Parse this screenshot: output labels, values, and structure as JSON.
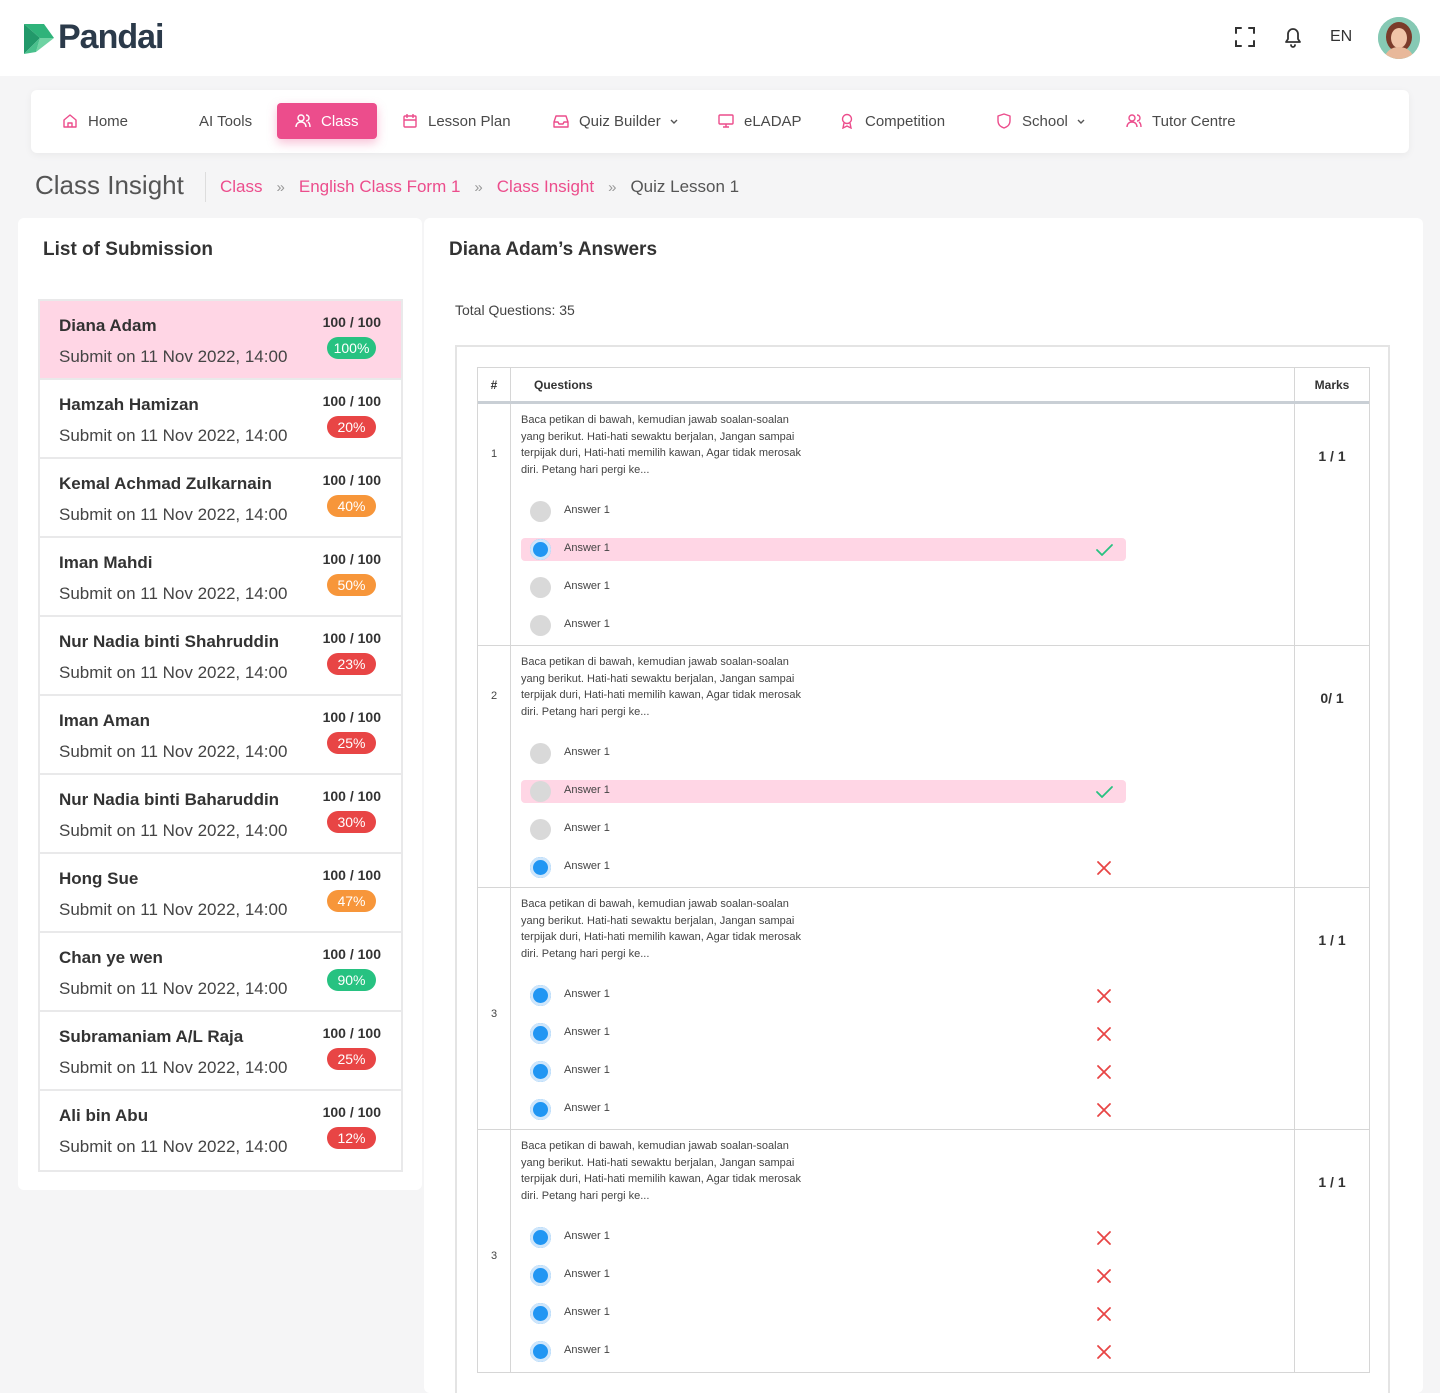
{
  "header": {
    "brand": "Pandai",
    "language": "EN",
    "colors": {
      "accent": "#ec4d8c",
      "logo_green": "#2fb37a",
      "text_dark": "#2b3a4a"
    }
  },
  "nav": {
    "items": [
      {
        "label": "Home",
        "icon": "home-icon"
      },
      {
        "label": "AI Tools",
        "icon": ""
      },
      {
        "label": "Class",
        "icon": "users-icon",
        "active": true
      },
      {
        "label": "Lesson Plan",
        "icon": "calendar-icon"
      },
      {
        "label": "Quiz Builder",
        "icon": "inbox-icon",
        "dropdown": true
      },
      {
        "label": "eLADAP",
        "icon": "monitor-icon"
      },
      {
        "label": "Competition",
        "icon": "award-icon"
      },
      {
        "label": "School",
        "icon": "shield-icon",
        "dropdown": true
      },
      {
        "label": "Tutor Centre",
        "icon": "users-icon"
      }
    ]
  },
  "page": {
    "title": "Class Insight",
    "breadcrumb": [
      "Class",
      "English Class Form 1",
      "Class Insight",
      "Quiz Lesson 1"
    ]
  },
  "submissions": {
    "title": "List of Submission",
    "items": [
      {
        "name": "Diana Adam",
        "date": "Submit on 11 Nov 2022, 14:00",
        "score": "100 / 100",
        "percent": "100%",
        "badge_color": "#27c281",
        "active": true
      },
      {
        "name": "Hamzah Hamizan",
        "date": "Submit on 11 Nov 2022, 14:00",
        "score": "100 / 100",
        "percent": "20%",
        "badge_color": "#e84545"
      },
      {
        "name": "Kemal Achmad Zulkarnain",
        "date": "Submit on 11 Nov 2022, 14:00",
        "score": "100 / 100",
        "percent": "40%",
        "badge_color": "#f7963a"
      },
      {
        "name": "Iman Mahdi",
        "date": "Submit on 11 Nov 2022, 14:00",
        "score": "100 / 100",
        "percent": "50%",
        "badge_color": "#f7963a"
      },
      {
        "name": "Nur Nadia binti Shahruddin",
        "date": "Submit on 11 Nov 2022, 14:00",
        "score": "100 / 100",
        "percent": "23%",
        "badge_color": "#e84545"
      },
      {
        "name": "Iman Aman",
        "date": "Submit on 11 Nov 2022, 14:00",
        "score": "100 / 100",
        "percent": "25%",
        "badge_color": "#e84545"
      },
      {
        "name": "Nur Nadia binti Baharuddin",
        "date": "Submit on 11 Nov 2022, 14:00",
        "score": "100 / 100",
        "percent": "30%",
        "badge_color": "#e84545"
      },
      {
        "name": "Hong Sue",
        "date": "Submit on 11 Nov 2022, 14:00",
        "score": "100 / 100",
        "percent": "47%",
        "badge_color": "#f7963a"
      },
      {
        "name": "Chan ye wen",
        "date": "Submit on 11 Nov 2022, 14:00",
        "score": "100 / 100",
        "percent": "90%",
        "badge_color": "#27c281"
      },
      {
        "name": "Subramaniam A/L Raja",
        "date": "Submit on 11 Nov 2022, 14:00",
        "score": "100 / 100",
        "percent": "25%",
        "badge_color": "#e84545"
      },
      {
        "name": "Ali bin Abu",
        "date": "Submit on 11 Nov 2022, 14:00",
        "score": "100 / 100",
        "percent": "12%",
        "badge_color": "#e84545"
      }
    ]
  },
  "answers": {
    "title": "Diana Adam’s Answers",
    "total_questions": "Total Questions: 35",
    "columns": {
      "num": "#",
      "questions": "Questions",
      "marks": "Marks"
    },
    "questions": [
      {
        "num": "1",
        "text": "Baca petikan di bawah, kemudian jawab soalan-soalan yang berikut. Hati-hati sewaktu berjalan, Jangan sampai terpijak duri, Hati-hati memilih kawan, Agar tidak merosak diri. Petang hari pergi ke...",
        "marks": "1 / 1",
        "options": [
          {
            "label": "Answer 1",
            "selected": false,
            "highlight": false,
            "result": ""
          },
          {
            "label": "Answer 1",
            "selected": true,
            "highlight": true,
            "result": "correct"
          },
          {
            "label": "Answer 1",
            "selected": false,
            "highlight": false,
            "result": ""
          },
          {
            "label": "Answer 1",
            "selected": false,
            "highlight": false,
            "result": ""
          }
        ]
      },
      {
        "num": "2",
        "text": "Baca petikan di bawah, kemudian jawab soalan-soalan yang berikut. Hati-hati sewaktu berjalan, Jangan sampai terpijak duri, Hati-hati memilih kawan, Agar tidak merosak diri. Petang hari pergi ke...",
        "marks": "0/ 1",
        "options": [
          {
            "label": "Answer 1",
            "selected": false,
            "highlight": false,
            "result": ""
          },
          {
            "label": "Answer 1",
            "selected": false,
            "highlight": true,
            "result": "correct"
          },
          {
            "label": "Answer 1",
            "selected": false,
            "highlight": false,
            "result": ""
          },
          {
            "label": "Answer 1",
            "selected": true,
            "highlight": false,
            "result": "wrong"
          }
        ]
      },
      {
        "num": "3",
        "text": "Baca petikan di bawah, kemudian jawab soalan-soalan yang berikut. Hati-hati sewaktu berjalan, Jangan sampai terpijak duri, Hati-hati memilih kawan, Agar tidak merosak diri. Petang hari pergi ke...",
        "marks": "1 / 1",
        "options": [
          {
            "label": "Answer 1",
            "selected": true,
            "highlight": false,
            "result": "wrong"
          },
          {
            "label": "Answer 1",
            "selected": true,
            "highlight": false,
            "result": "wrong"
          },
          {
            "label": "Answer 1",
            "selected": true,
            "highlight": false,
            "result": "wrong"
          },
          {
            "label": "Answer 1",
            "selected": true,
            "highlight": false,
            "result": "wrong"
          }
        ]
      },
      {
        "num": "3",
        "text": "Baca petikan di bawah, kemudian jawab soalan-soalan yang berikut. Hati-hati sewaktu berjalan, Jangan sampai terpijak duri, Hati-hati memilih kawan, Agar tidak merosak diri. Petang hari pergi ke...",
        "marks": "1 / 1",
        "options": [
          {
            "label": "Answer 1",
            "selected": true,
            "highlight": false,
            "result": "wrong"
          },
          {
            "label": "Answer 1",
            "selected": true,
            "highlight": false,
            "result": "wrong"
          },
          {
            "label": "Answer 1",
            "selected": true,
            "highlight": false,
            "result": "wrong"
          },
          {
            "label": "Answer 1",
            "selected": true,
            "highlight": false,
            "result": "wrong"
          }
        ]
      }
    ]
  }
}
